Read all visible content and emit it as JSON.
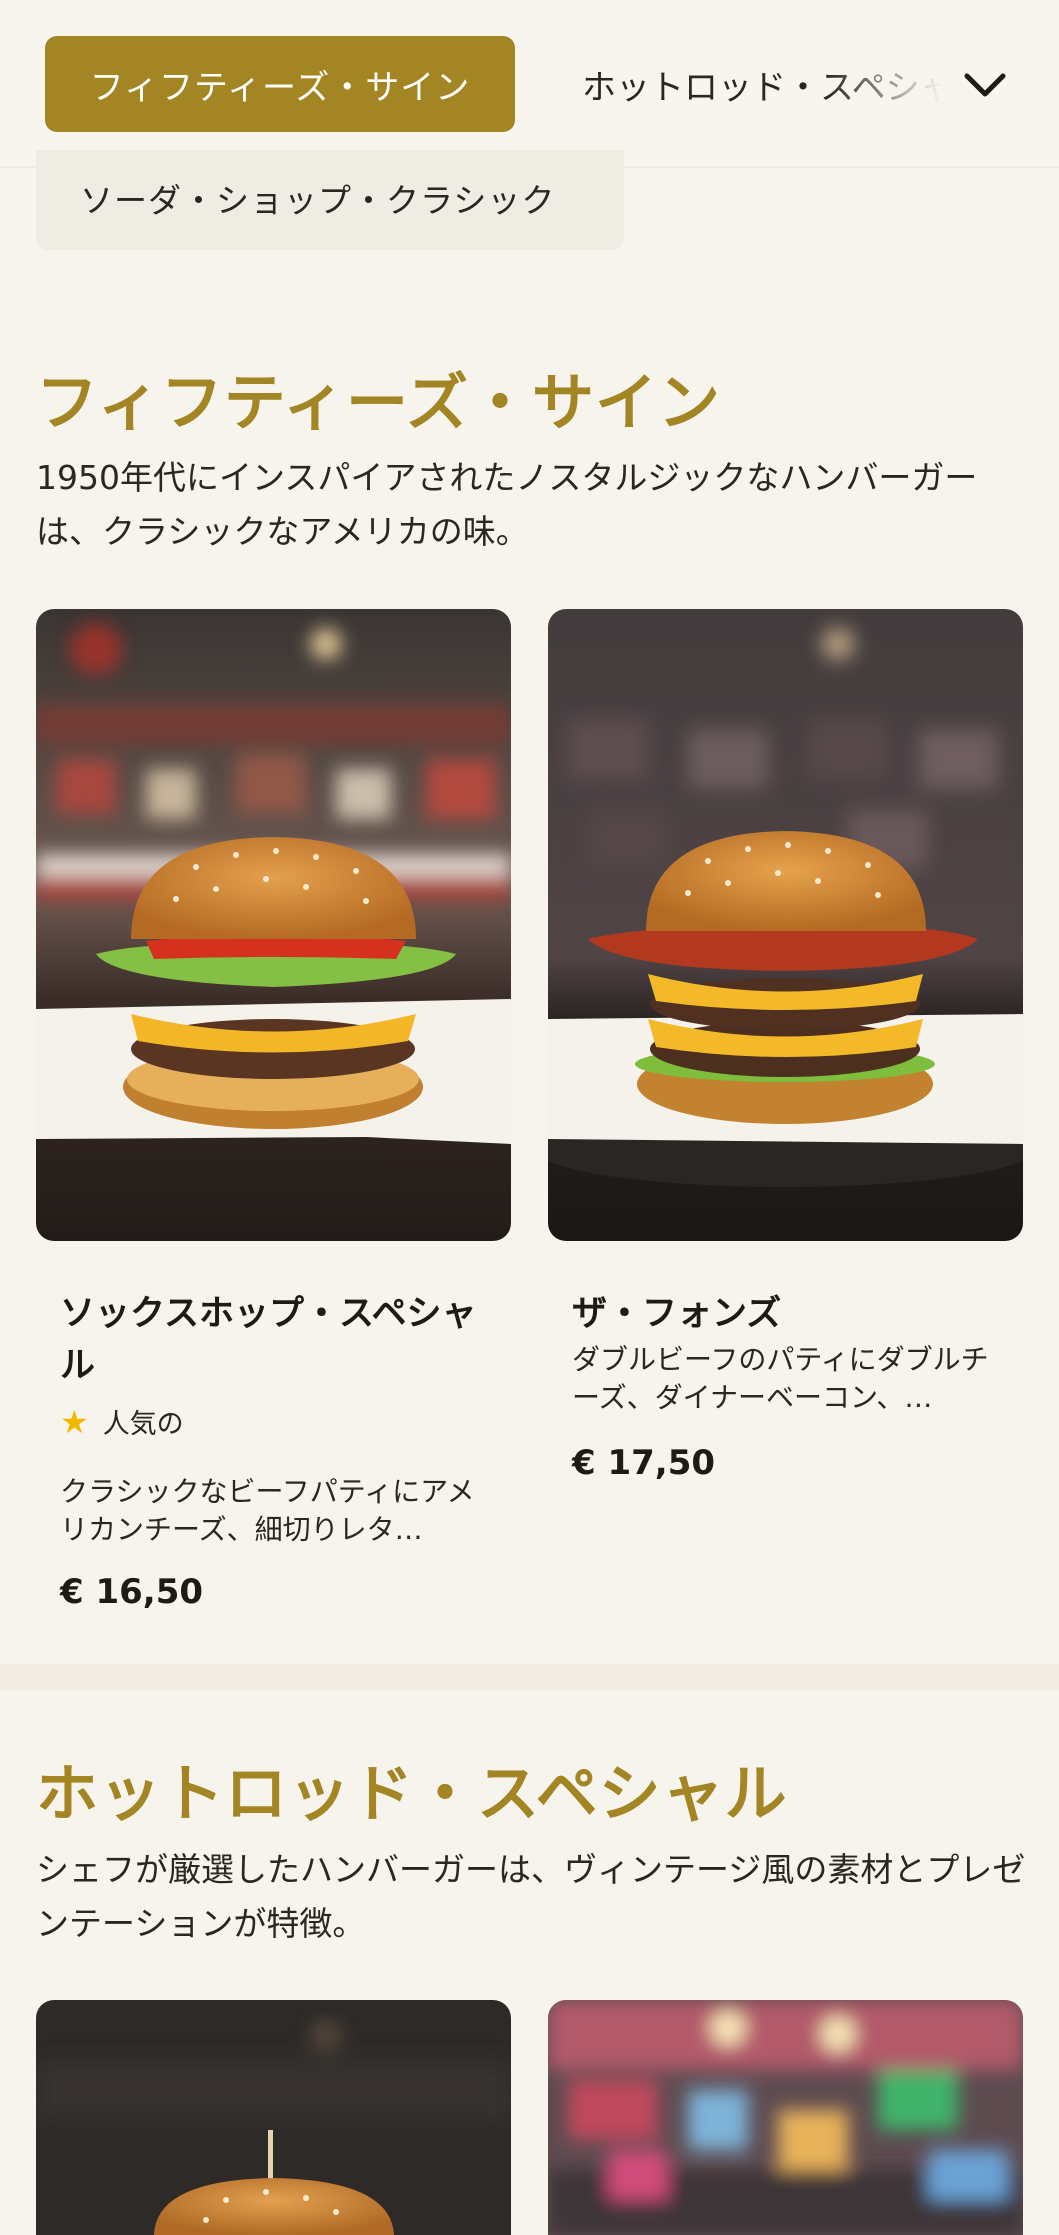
{
  "nav": {
    "active_label": "フィフティーズ・サイン",
    "next_label": "ホットロッド・スペシャル",
    "chevron_icon": "chevron-down-icon"
  },
  "chip": {
    "label": "ソーダ・ショップ・クラシック"
  },
  "sections": [
    {
      "title": "フィフティーズ・サイン",
      "description": "1950年代にインスパイアされたノスタルジックなハンバーガーは、クラシックなアメリカの味。",
      "items": [
        {
          "title": "ソックスホップ・スペシャル",
          "badge": "人気の",
          "badge_icon": "star-icon",
          "description": "クラシックなビーフパティにアメリカンチーズ、細切りレタ…",
          "price": "€ 16,50"
        },
        {
          "title": "ザ・フォンズ",
          "description": "ダブルビーフのパティにダブルチーズ、ダイナーベーコン、…",
          "price": "€ 17,50"
        }
      ]
    },
    {
      "title": "ホットロッド・スペシャル",
      "description": "シェフが厳選したハンバーガーは、ヴィンテージ風の素材とプレゼンテーションが特徴。"
    }
  ],
  "colors": {
    "accent": "#a38524",
    "background": "#f7f4ee",
    "star": "#f2b800"
  }
}
